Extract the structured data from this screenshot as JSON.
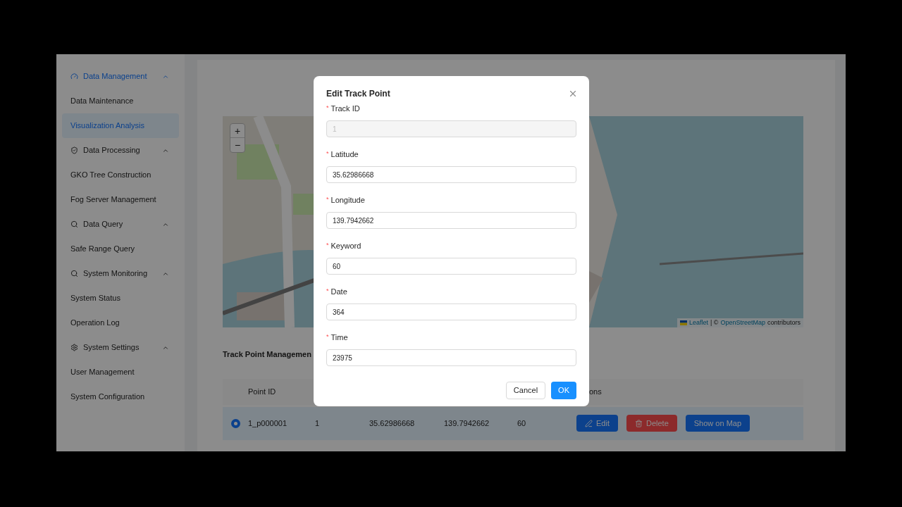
{
  "sidebar": {
    "groups": [
      {
        "label": "Data Management",
        "expanded": true,
        "items": [
          {
            "label": "Data Maintenance",
            "selected": false
          },
          {
            "label": "Visualization Analysis",
            "selected": true
          }
        ]
      },
      {
        "label": "Data Processing",
        "expanded": true,
        "items": [
          {
            "label": "GKO Tree Construction",
            "selected": false
          },
          {
            "label": "Fog Server Management",
            "selected": false
          }
        ]
      },
      {
        "label": "Data Query",
        "expanded": true,
        "items": [
          {
            "label": "Safe Range Query",
            "selected": false
          }
        ]
      },
      {
        "label": "System Monitoring",
        "expanded": true,
        "items": [
          {
            "label": "System Status",
            "selected": false
          },
          {
            "label": "Operation Log",
            "selected": false
          }
        ]
      },
      {
        "label": "System Settings",
        "expanded": true,
        "items": [
          {
            "label": "User Management",
            "selected": false
          },
          {
            "label": "System Configuration",
            "selected": false
          }
        ]
      }
    ]
  },
  "map": {
    "zoom_in": "+",
    "zoom_out": "−",
    "attribution": {
      "leaflet": "Leaflet",
      "separator": "| ©",
      "osm": "OpenStreetMap",
      "suffix": "contributors"
    }
  },
  "table": {
    "title": "Track Point Managemen",
    "header": {
      "column_2": "Point ID",
      "column_7": "ons"
    },
    "rows": [
      {
        "selected": true,
        "cells": [
          "1_p000001",
          "1",
          "35.62986668",
          "139.7942662",
          "60"
        ],
        "actions": [
          {
            "kind": "edit",
            "label": "Edit"
          },
          {
            "kind": "delete",
            "label": "Delete"
          },
          {
            "kind": "map",
            "label": "Show on Map"
          }
        ]
      }
    ]
  },
  "dialog": {
    "title": "Edit Track Point",
    "fields": [
      {
        "required_mark": "*",
        "label": "Track ID",
        "value": "1",
        "disabled": true
      },
      {
        "required_mark": "*",
        "label": "Latitude",
        "value": "35.62986668",
        "disabled": false
      },
      {
        "required_mark": "*",
        "label": "Longitude",
        "value": "139.7942662",
        "disabled": false
      },
      {
        "required_mark": "*",
        "label": "Keyword",
        "value": "60",
        "disabled": false
      },
      {
        "required_mark": "*",
        "label": "Date",
        "value": "364",
        "disabled": false
      },
      {
        "required_mark": "*",
        "label": "Time",
        "value": "23975",
        "disabled": false
      }
    ],
    "buttons": [
      {
        "kind": "cancel",
        "label": "Cancel"
      },
      {
        "kind": "ok",
        "label": "OK"
      }
    ]
  }
}
